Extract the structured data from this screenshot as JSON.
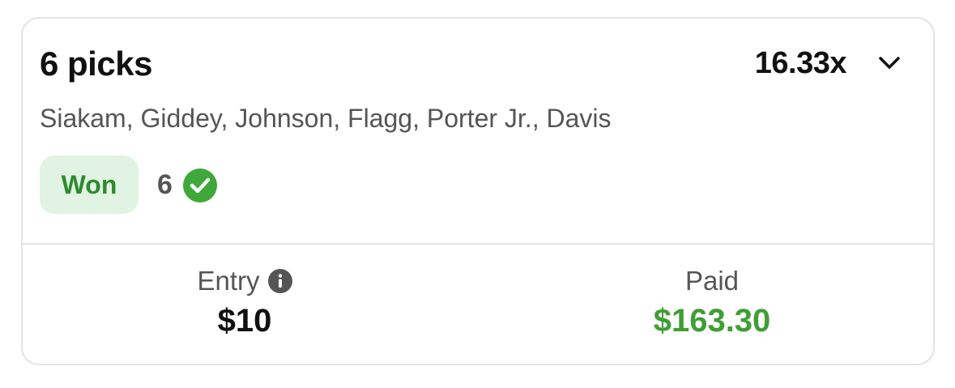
{
  "card": {
    "title": "6 picks",
    "multiplier": "16.33x",
    "players": "Siakam, Giddey, Johnson, Flagg, Porter Jr., Davis",
    "status_badge": "Won",
    "correct_count": "6",
    "icons": {
      "expand": "chevron-down-icon",
      "correct": "check-circle-icon",
      "info": "info-icon"
    }
  },
  "summary": {
    "entry_label": "Entry",
    "entry_value": "$10",
    "paid_label": "Paid",
    "paid_value": "$163.30"
  },
  "colors": {
    "won_badge_bg": "#e1f3e3",
    "won_text": "#2e8a2e",
    "check_green": "#3fa83a",
    "paid_green": "#3f9e34"
  }
}
